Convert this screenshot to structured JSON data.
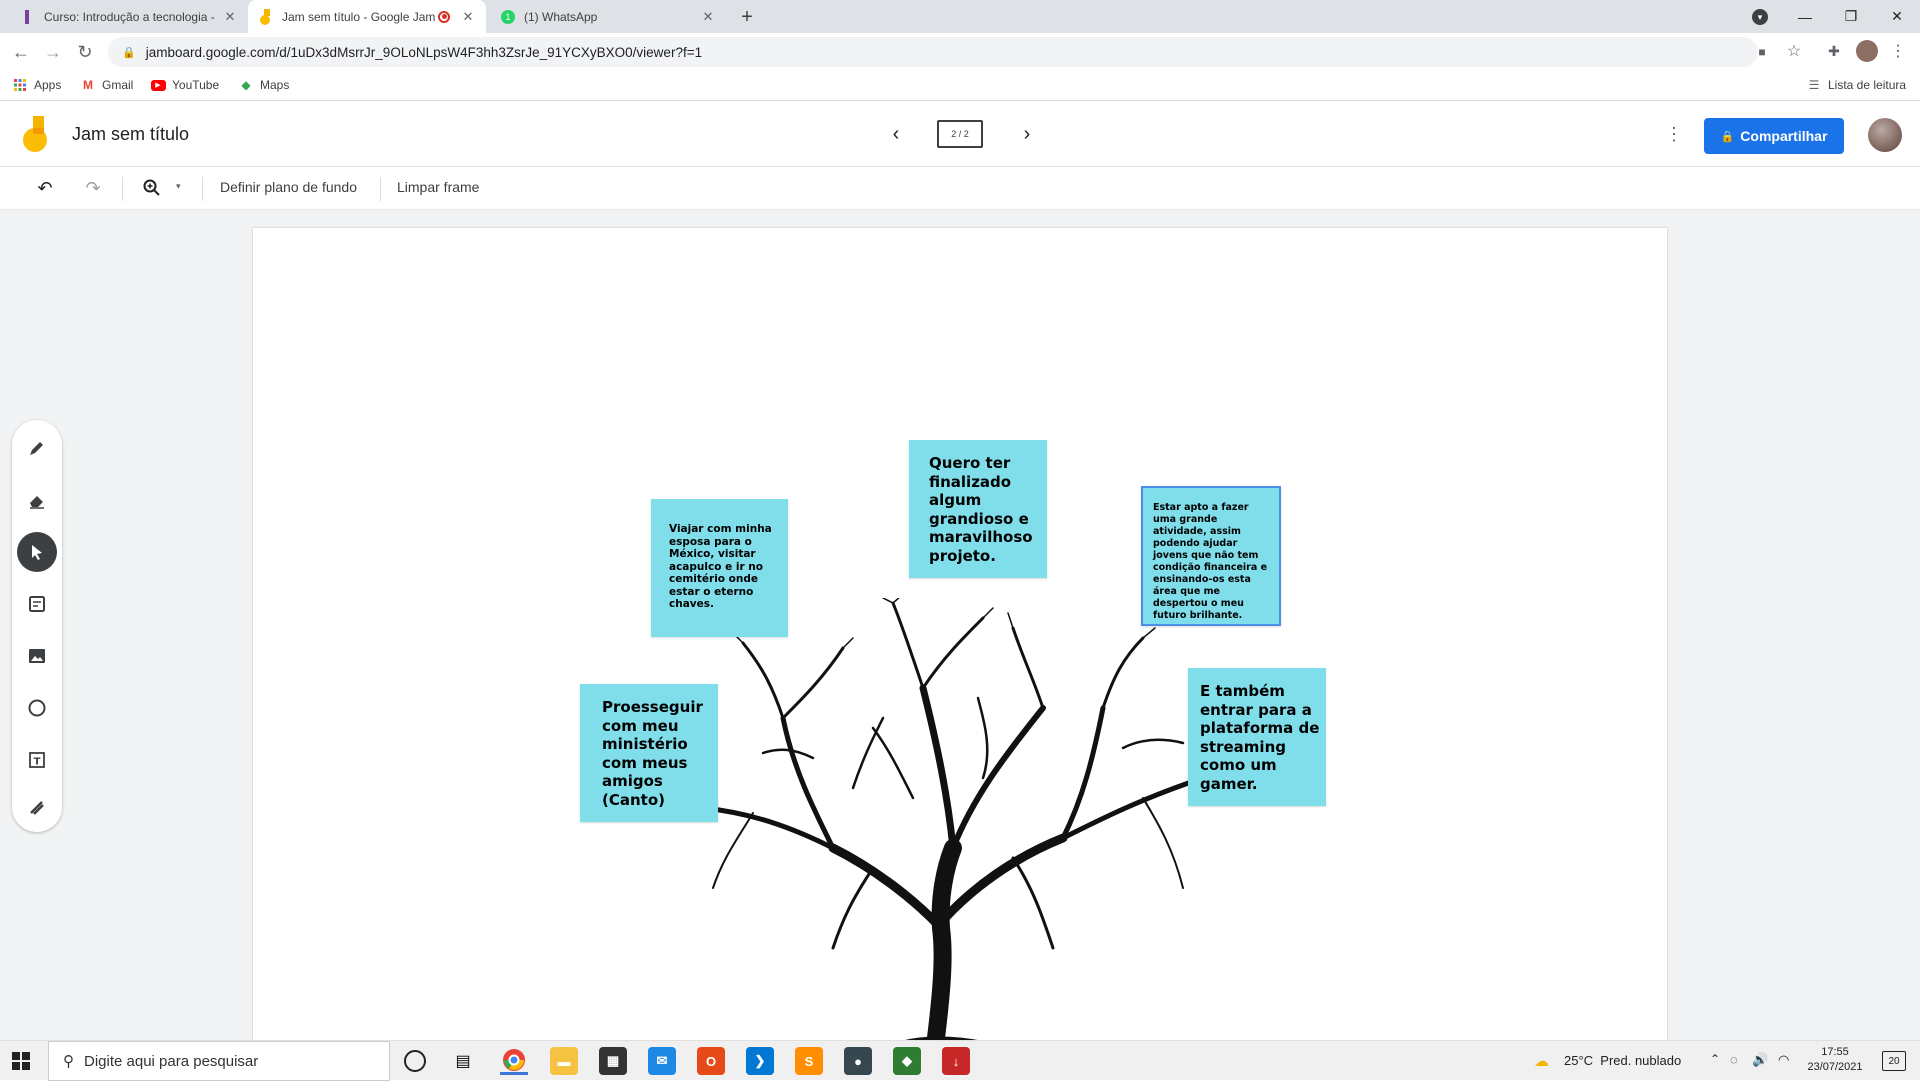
{
  "browser": {
    "tabs": [
      {
        "title": "Curso: Introdução a tecnologia -",
        "active": false
      },
      {
        "title": "Jam sem título - Google Jam",
        "active": true
      },
      {
        "title": "(1) WhatsApp",
        "active": false
      }
    ],
    "new_tab_label": "+",
    "url": "jamboard.google.com/d/1uDx3dMsrrJr_9OLoNLpsW4F3hh3ZsrJe_91YCXyBXO0/viewer?f=1",
    "bookmarks": [
      "Apps",
      "Gmail",
      "YouTube",
      "Maps"
    ],
    "reading_list": "Lista de leitura"
  },
  "jamboard": {
    "title": "Jam sem título",
    "frame_indicator": "2 / 2",
    "share_label": "Compartilhar",
    "set_background_label": "Definir plano de fundo",
    "clear_frame_label": "Limpar frame"
  },
  "notes": [
    {
      "text": "Viajar com minha esposa para o México, visitar acapulco e ir no cemitério onde estar o eterno chaves."
    },
    {
      "text": "Quero ter finalizado algum grandioso e maravilhoso projeto."
    },
    {
      "text": "Estar apto a fazer uma grande atividade, assim podendo ajudar jovens que não tem condição financeira e ensinando-os esta área que me despertou o meu futuro brilhante."
    },
    {
      "text": "Proesseguir com meu ministério com meus amigos (Canto)"
    },
    {
      "text": "E também entrar para a plataforma de streaming como um gamer."
    }
  ],
  "taskbar": {
    "search_placeholder": "Digite aqui para pesquisar",
    "weather": "25°C  Pred. nublado",
    "time": "17:55",
    "date": "23/07/2021",
    "notifications": "20"
  },
  "colors": {
    "sticky": "#80deea",
    "share_button": "#1a73e8",
    "jamboard_orange": "#f4b400"
  }
}
